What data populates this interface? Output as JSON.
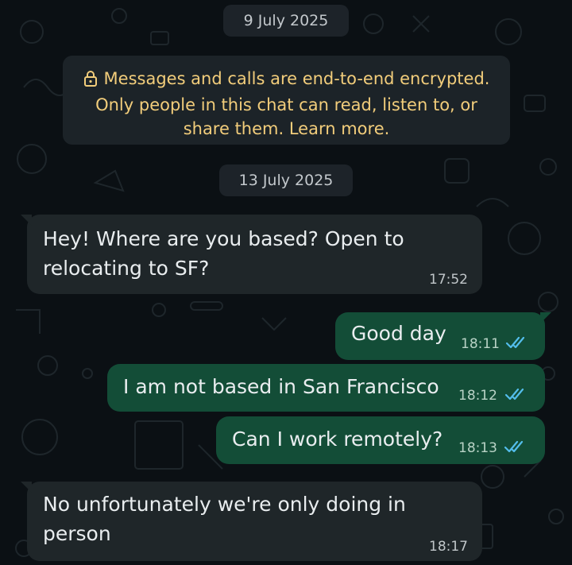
{
  "dates": [
    "9 July 2025",
    "13 July 2025"
  ],
  "encryption_notice": {
    "lines": [
      "Messages and calls are end-to-end encrypted.",
      "Only people in this chat can read, listen to, or",
      "share them. Learn more."
    ],
    "icon": "lock-icon"
  },
  "messages": [
    {
      "direction": "incoming",
      "lines": [
        "Hey! Where are you based? Open to",
        "relocating to SF?"
      ],
      "time": "17:52"
    },
    {
      "direction": "outgoing",
      "lines": [
        "Good day"
      ],
      "time": "18:11",
      "status": "read"
    },
    {
      "direction": "outgoing",
      "lines": [
        "I am not based in San Francisco"
      ],
      "time": "18:12",
      "status": "read"
    },
    {
      "direction": "outgoing",
      "lines": [
        "Can I work remotely?"
      ],
      "time": "18:13",
      "status": "read"
    },
    {
      "direction": "incoming",
      "lines": [
        "No unfortunately we're only doing in",
        "person"
      ],
      "time": "18:17"
    }
  ],
  "colors": {
    "background": "#0b1014",
    "incoming_bubble": "#1f2629",
    "outgoing_bubble": "#134d37",
    "read_ticks": "#53bdeb",
    "notice_text": "#f2cd7b"
  }
}
